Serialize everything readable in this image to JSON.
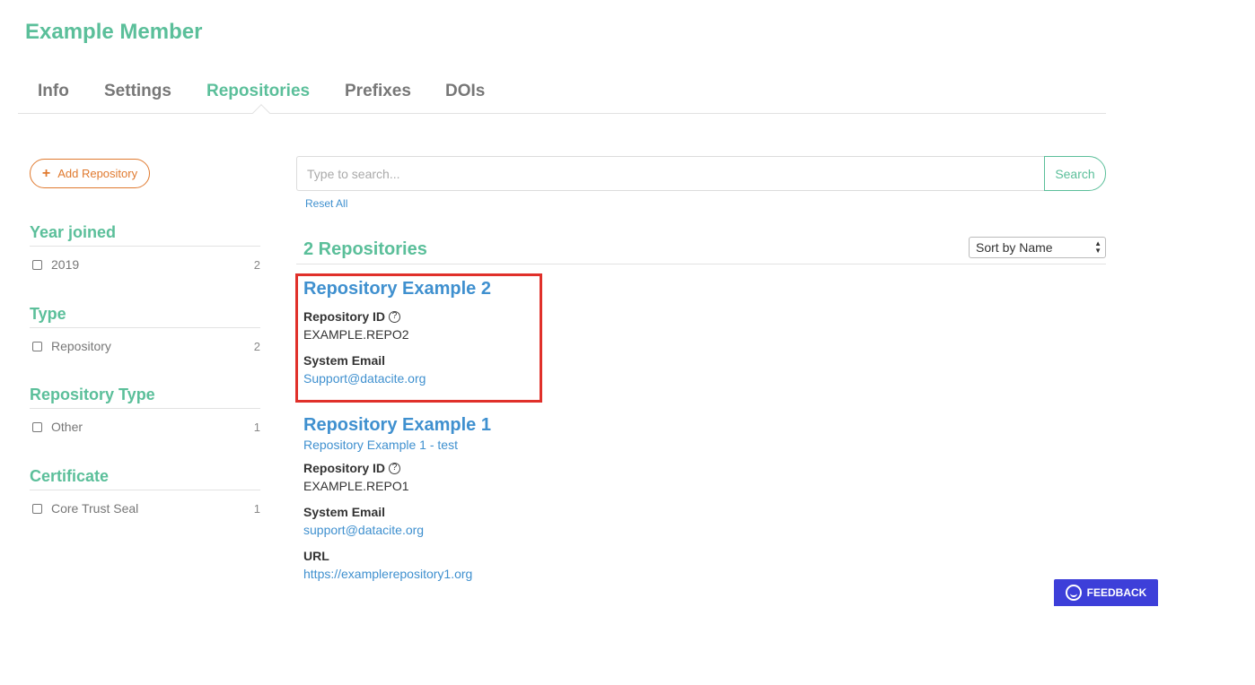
{
  "header": {
    "title": "Example Member"
  },
  "tabs": [
    {
      "label": "Info"
    },
    {
      "label": "Settings"
    },
    {
      "label": "Repositories"
    },
    {
      "label": "Prefixes"
    },
    {
      "label": "DOIs"
    }
  ],
  "active_tab": "Repositories",
  "sidebar": {
    "add_button": "Add Repository",
    "facets": [
      {
        "title": "Year joined",
        "items": [
          {
            "label": "2019",
            "count": "2"
          }
        ]
      },
      {
        "title": "Type",
        "items": [
          {
            "label": "Repository",
            "count": "2"
          }
        ]
      },
      {
        "title": "Repository Type",
        "items": [
          {
            "label": "Other",
            "count": "1"
          }
        ]
      },
      {
        "title": "Certificate",
        "items": [
          {
            "label": "Core Trust Seal",
            "count": "1"
          }
        ]
      }
    ]
  },
  "search": {
    "placeholder": "Type to search...",
    "button": "Search",
    "reset": "Reset All"
  },
  "results": {
    "count_label": "2 Repositories",
    "sort": "Sort by Name",
    "items": [
      {
        "title": "Repository Example 2",
        "id_label": "Repository ID",
        "id": "EXAMPLE.REPO2",
        "email_label": "System Email",
        "email": "Support@datacite.org"
      },
      {
        "title": "Repository Example 1",
        "subtitle": "Repository Example 1 - test",
        "id_label": "Repository ID",
        "id": "EXAMPLE.REPO1",
        "email_label": "System Email",
        "email": "support@datacite.org",
        "url_label": "URL",
        "url": "https://examplerepository1.org"
      }
    ]
  },
  "feedback": {
    "label": "FEEDBACK"
  },
  "colors": {
    "accent": "#5bbf9a",
    "link": "#3f90cf",
    "orange": "#e07a2f",
    "highlight": "#e0302a",
    "feedback_bg": "#3d3fd9"
  }
}
